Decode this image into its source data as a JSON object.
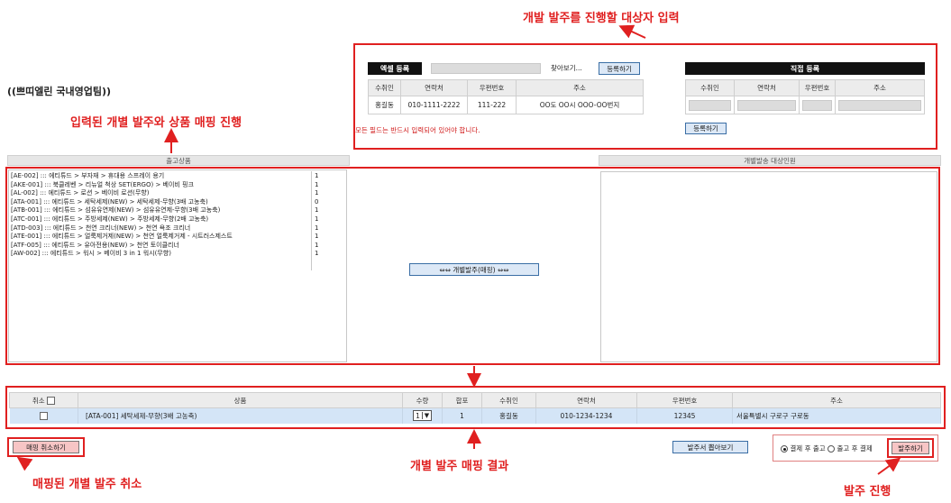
{
  "annotations": {
    "top": "개발 발주를 진행할 대상자 입력",
    "brand": "((쁘띠엘린 국내영업팀))",
    "mapping": "입력된 개별 발주와 상품 매핑 진행",
    "result": "개별 발주 매핑 결과",
    "cancel": "매핑된 개별 발주 취소",
    "order": "발주 진행"
  },
  "excel": {
    "title": "엑셀 등록",
    "browse_label": "찾아보기...",
    "register_label": "등록하기",
    "headers": [
      "수취인",
      "연락처",
      "우편번호",
      "주소"
    ],
    "row": [
      "홍길동",
      "010-1111-2222",
      "111-222",
      "OO도 OO시 OOO-OO번지"
    ],
    "note": "모든 필드는 반드시 입력되어 있어야 합니다."
  },
  "direct": {
    "title": "직접 등록",
    "headers": [
      "수취인",
      "연락처",
      "우편번호",
      "주소"
    ],
    "register_label": "등록하기"
  },
  "sections": {
    "left_header": "출고상품",
    "right_header": "개별발송 대상인원"
  },
  "products": [
    {
      "text": "[AE-002] ::: 에티튜드 > 부자재 > 휴대용 스프레이 용기",
      "qty": "1"
    },
    {
      "text": "[AKE-001] ::: 북클레벤 > 리뉴얼 척상 SET(ERGO) > 베이비 핑크",
      "qty": "1"
    },
    {
      "text": "[AL-002] ::: 에티튜드 > 로션 > 베이비 로션(무향)",
      "qty": "1"
    },
    {
      "text": "[ATA-001] ::: 에티튜드 > 세탁세제(NEW) > 세탁세제-무향(3배 고농축)",
      "qty": "0"
    },
    {
      "text": "[ATB-001] ::: 에티튜드 > 섬유유연제(NEW) > 섬유유연제-무향(3배 고농축)",
      "qty": "1"
    },
    {
      "text": "[ATC-001] ::: 에티튜드 > 주방세제(NEW) > 주방세제-무향(2배 고농축)",
      "qty": "1"
    },
    {
      "text": "[ATD-003] ::: 에티튜드 > 천연 크리너(NEW) > 천연 욕조 크리너",
      "qty": "1"
    },
    {
      "text": "[ATE-001] ::: 에티튜드 > 얼룩제거제(NEW) > 천연 얼룩제거제 - 시트러스제스트",
      "qty": "1"
    },
    {
      "text": "[ATF-005] ::: 에티튜드 > 유아전용(NEW) > 천연 토이클리너",
      "qty": "1"
    },
    {
      "text": "[AW-002] ::: 에티튜드 > 워시 > 베이비 3 in 1 워시(무향)",
      "qty": "1"
    }
  ],
  "mapping_button": "⇔⇔ 개별발주(매핑) ⇔⇔",
  "result_table": {
    "headers": [
      "취소",
      "상품",
      "수량",
      "합포",
      "수취인",
      "연락처",
      "우편번호",
      "주소"
    ],
    "row": {
      "product": "[ATA-001] 세탁세제-무향(3배 고농축)",
      "qty": "1",
      "hapo": "1",
      "recipient": "홍길동",
      "phone": "010-1234-1234",
      "zip": "12345",
      "address": "서울특별시 구로구 구로동"
    }
  },
  "footer": {
    "cancel_label": "매핑 취소하기",
    "print_label": "발주서 뽑아보기",
    "radio1": "결제 후 출고",
    "radio2": "출고 후 결제",
    "order_label": "발주하기"
  },
  "colors": {
    "annotation_red": "#e02020",
    "header_black": "#111111",
    "button_blue": "#dce8f6",
    "row_blue": "#d4e5f7"
  }
}
